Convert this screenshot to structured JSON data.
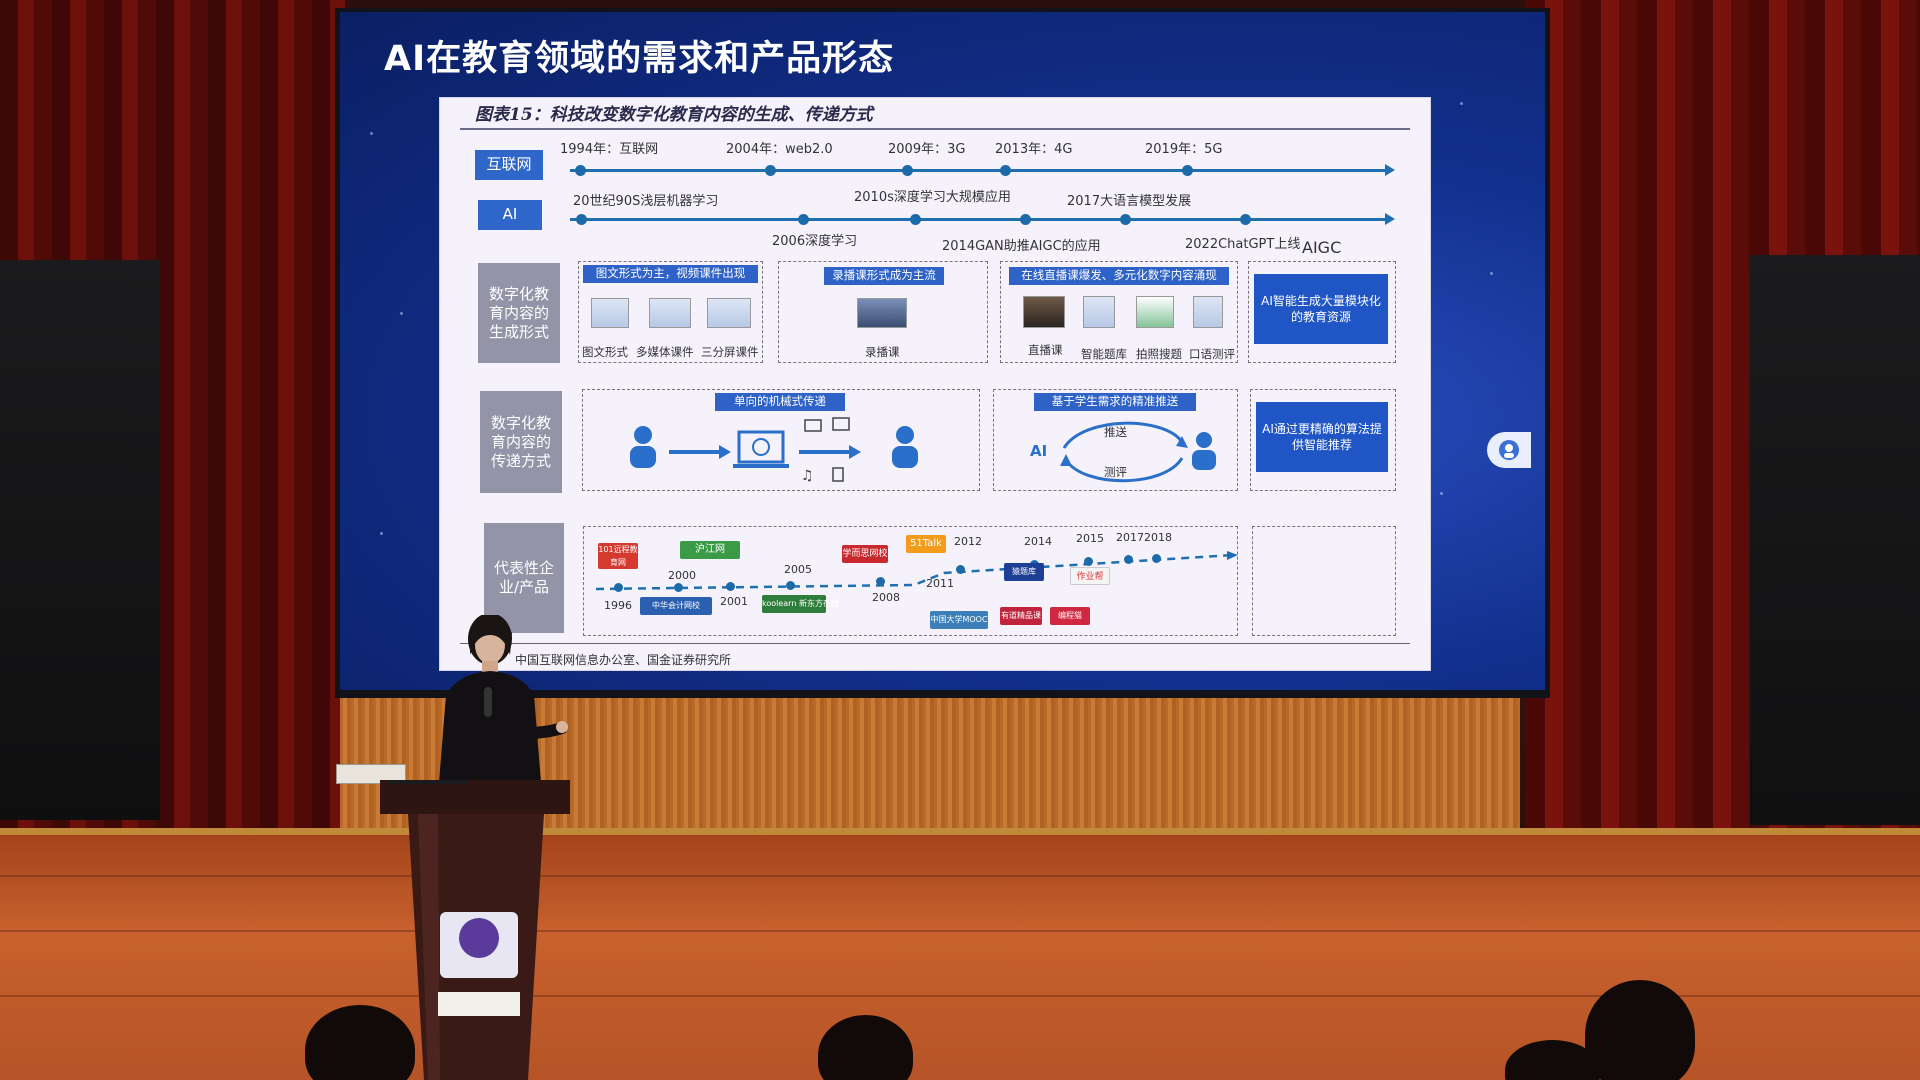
{
  "slide": {
    "title": "AI在教育领域的需求和产品形态",
    "figure_caption": "图表15：科技改变数字化教育内容的生成、传递方式",
    "source_note": "中国互联网信息办公室、国金证券研究所"
  },
  "timeline_internet": {
    "tag": "互联网",
    "events": [
      "1994年：互联网",
      "2004年：web2.0",
      "2009年：3G",
      "2013年：4G",
      "2019年：5G"
    ]
  },
  "timeline_ai": {
    "tag": "AI",
    "events_top": [
      "20世纪90S浅层机器学习",
      "2010s深度学习大规模应用",
      "2017大语言模型发展"
    ],
    "events_bottom": [
      "2006深度学习",
      "2014GAN助推AIGC的应用",
      "2022ChatGPT上线"
    ],
    "end_label": "AIGC"
  },
  "row_generation": {
    "label": "数字化教育内容的生成形式",
    "box1": {
      "head": "图文形式为主，视频课件出现",
      "captions": [
        "图文形式",
        "多媒体课件",
        "三分屏课件"
      ]
    },
    "box2": {
      "head": "录播课形式成为主流",
      "captions": [
        "录播课"
      ]
    },
    "box3": {
      "head": "在线直播课爆发、多元化数字内容涌现",
      "captions": [
        "直播课",
        "智能题库",
        "拍照搜题",
        "口语测评"
      ]
    },
    "aigc": "AI智能生成大量模块化的教育资源"
  },
  "row_delivery": {
    "label": "数字化教育内容的传递方式",
    "box1": {
      "head": "单向的机械式传递"
    },
    "box2": {
      "head": "基于学生需求的精准推送",
      "ai_label": "AI",
      "push": "推送",
      "assess": "测评"
    },
    "aigc": "AI通过更精确的算法提供智能推荐"
  },
  "row_products": {
    "label": "代表性企业/产品",
    "years": [
      "1996",
      "2000",
      "2001",
      "2005",
      "2008",
      "2011",
      "2012",
      "2014",
      "2015",
      "2017",
      "2018"
    ],
    "logos": [
      "101远程教育网",
      "沪江网",
      "中华会计网校",
      "koolearn 新东方在线",
      "学而思网校",
      "51Talk",
      "猿题库",
      "作业帮",
      "编程猫",
      "有道精品课",
      "中国大学MOOC"
    ]
  },
  "colors": {
    "screen_blue": "#12308e",
    "tag_blue": "#2e67c9",
    "timeline_blue": "#1f6fb0",
    "curtain_red": "#6d0f0b",
    "floor_wood": "#c8612d"
  }
}
